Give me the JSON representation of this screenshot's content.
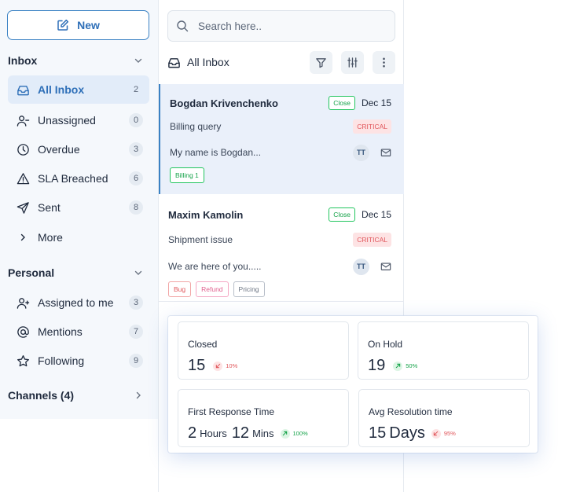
{
  "sidebar": {
    "new_label": "New",
    "inbox_section": {
      "title": "Inbox",
      "items": [
        {
          "label": "All Inbox",
          "count": "2",
          "icon": "inbox-icon",
          "active": true
        },
        {
          "label": "Unassigned",
          "count": "0",
          "icon": "user-minus-icon"
        },
        {
          "label": "Overdue",
          "count": "3",
          "icon": "clock-icon"
        },
        {
          "label": "SLA Breached",
          "count": "6",
          "icon": "warning-icon"
        },
        {
          "label": "Sent",
          "count": "8",
          "icon": "send-icon"
        },
        {
          "label": "More",
          "icon": "chevron-right-icon"
        }
      ]
    },
    "personal_section": {
      "title": "Personal",
      "items": [
        {
          "label": "Assigned to me",
          "count": "3",
          "icon": "user-plus-icon"
        },
        {
          "label": "Mentions",
          "count": "7",
          "icon": "at-icon"
        },
        {
          "label": "Following",
          "count": "9",
          "icon": "star-icon"
        }
      ]
    },
    "channels_label": "Channels (4)"
  },
  "search": {
    "placeholder": "Search here.."
  },
  "inbox_header": {
    "title": "All Inbox"
  },
  "conversations": [
    {
      "name": "Bogdan Krivenchenko",
      "status": "Close",
      "date": "Dec 15",
      "subject": "Billing query",
      "priority": "CRITICAL",
      "preview": "My name is Bogdan...",
      "avatar": "TT",
      "tags": [
        {
          "label": "Billing 1",
          "color": "#16a34a"
        }
      ],
      "selected": true
    },
    {
      "name": "Maxim Kamolin",
      "status": "Close",
      "date": "Dec 15",
      "subject": "Shipment issue",
      "priority": "CRITICAL",
      "preview": "We are here of you.....",
      "avatar": "TT",
      "tags": [
        {
          "label": "Bug",
          "color": "#e0565b"
        },
        {
          "label": "Refund",
          "color": "#e0608e"
        },
        {
          "label": "Pricing",
          "color": "#6b7482"
        }
      ]
    }
  ],
  "stats": [
    {
      "label": "Closed",
      "value": "15",
      "trend": "down",
      "pct": "10%"
    },
    {
      "label": "On Hold",
      "value": "19",
      "trend": "up",
      "pct": "50%"
    },
    {
      "label": "First Response Time",
      "v1": "2",
      "u1": "Hours",
      "v2": "12",
      "u2": "Mins",
      "trend": "up",
      "pct": "100%"
    },
    {
      "label": "Avg Resolution time",
      "v1": "15",
      "u1": "Days",
      "trend": "down",
      "pct": "95%"
    }
  ],
  "colors": {
    "accent": "#2e6fb8",
    "critical": "#e0565b",
    "success": "#16a34a",
    "active_bg": "#e2ecf9"
  }
}
